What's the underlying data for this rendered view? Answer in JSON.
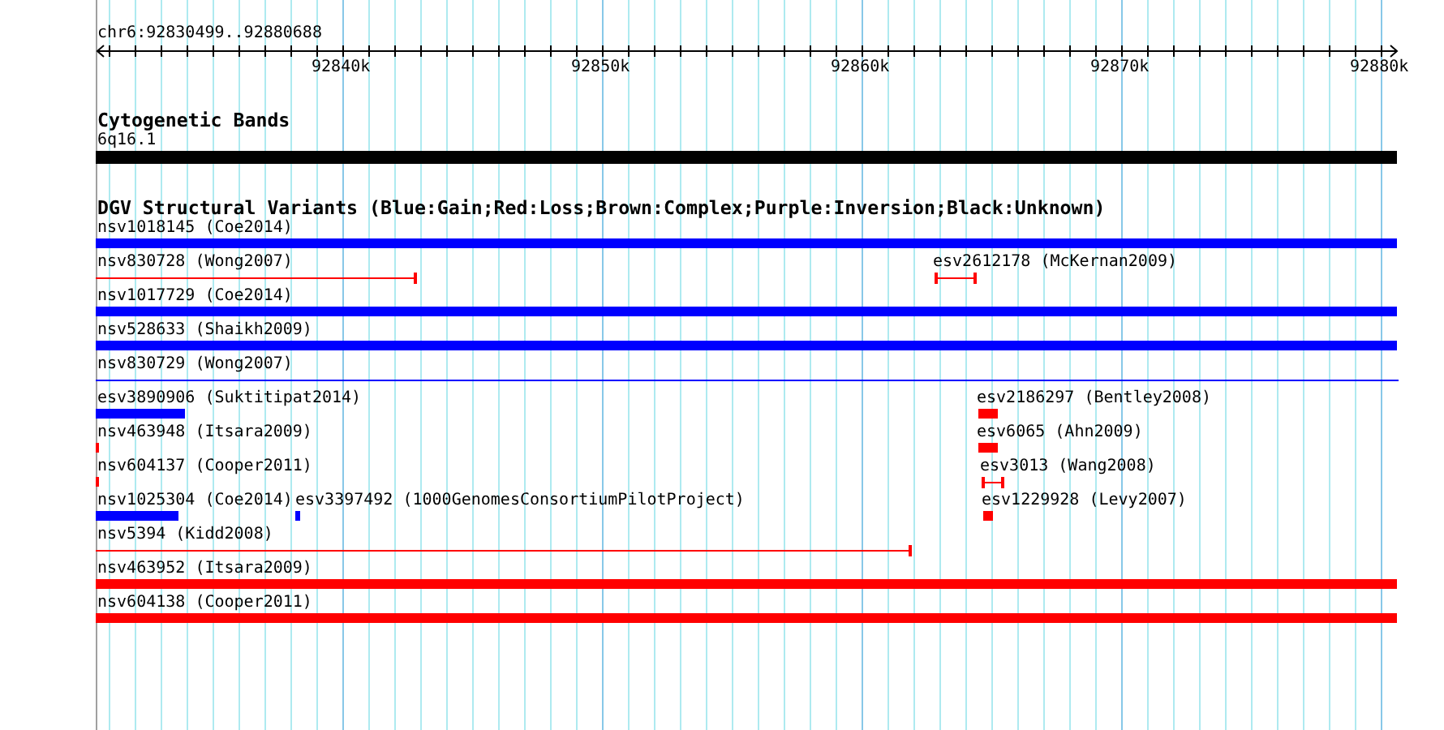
{
  "ruler": {
    "range": "chr6:92830499..92880688",
    "ticks": [
      "92840k",
      "92850k",
      "92860k",
      "92870k",
      "92880k"
    ]
  },
  "cytogenetic_bands": {
    "title": "Cytogenetic Bands",
    "features": [
      {
        "label": "6q16.1",
        "color": "#000000",
        "kind": "block"
      }
    ]
  },
  "structural_variants": {
    "title": "DGV Structural Variants (Blue:Gain;Red:Loss;Brown:Complex;Purple:Inversion;Black:Unknown)",
    "rows": [
      [
        {
          "label": "nsv1018145 (Coe2014)",
          "color": "#0000ff",
          "kind": "block"
        }
      ],
      [
        {
          "label": "nsv830728 (Wong2007)",
          "color": "#ff0000",
          "kind": "line"
        },
        {
          "label": "esv2612178 (McKernan2009)",
          "color": "#ff0000",
          "kind": "line"
        }
      ],
      [
        {
          "label": "nsv1017729 (Coe2014)",
          "color": "#0000ff",
          "kind": "block"
        }
      ],
      [
        {
          "label": "nsv528633 (Shaikh2009)",
          "color": "#0000ff",
          "kind": "block"
        }
      ],
      [
        {
          "label": "nsv830729 (Wong2007)",
          "color": "#0000ff",
          "kind": "line"
        }
      ],
      [
        {
          "label": "esv3890906 (Suktitipat2014)",
          "color": "#0000ff",
          "kind": "block"
        },
        {
          "label": "esv2186297 (Bentley2008)",
          "color": "#ff0000",
          "kind": "block"
        }
      ],
      [
        {
          "label": "nsv463948 (Itsara2009)",
          "color": "#ff0000",
          "kind": "block"
        },
        {
          "label": "esv6065 (Ahn2009)",
          "color": "#ff0000",
          "kind": "block"
        }
      ],
      [
        {
          "label": "nsv604137 (Cooper2011)",
          "color": "#ff0000",
          "kind": "block"
        },
        {
          "label": "esv3013 (Wang2008)",
          "color": "#ff0000",
          "kind": "line"
        }
      ],
      [
        {
          "label": "nsv1025304 (Coe2014)",
          "color": "#0000ff",
          "kind": "block"
        },
        {
          "label": "esv3397492 (1000GenomesConsortiumPilotProject)",
          "color": "#0000ff",
          "kind": "block"
        },
        {
          "label": "esv1229928 (Levy2007)",
          "color": "#ff0000",
          "kind": "block"
        }
      ],
      [
        {
          "label": "nsv5394 (Kidd2008)",
          "color": "#ff0000",
          "kind": "line"
        }
      ],
      [
        {
          "label": "nsv463952 (Itsara2009)",
          "color": "#ff0000",
          "kind": "block"
        }
      ],
      [
        {
          "label": "nsv604138 (Cooper2011)",
          "color": "#ff0000",
          "kind": "block"
        }
      ]
    ]
  }
}
